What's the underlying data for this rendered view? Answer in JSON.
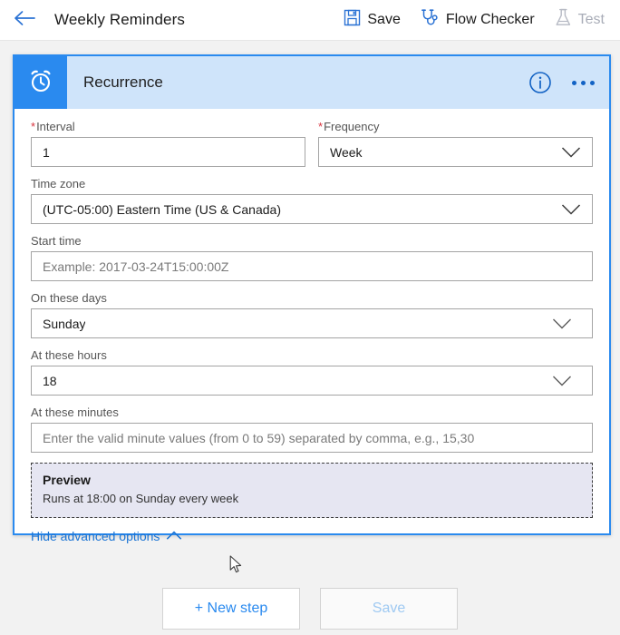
{
  "topbar": {
    "back_icon": "arrow-left-icon",
    "title": "Weekly Reminders",
    "actions": [
      {
        "label": "Save",
        "icon": "save-floppy-icon",
        "disabled": false
      },
      {
        "label": "Flow Checker",
        "icon": "stethoscope-icon",
        "disabled": false
      },
      {
        "label": "Test",
        "icon": "flask-icon",
        "disabled": true
      }
    ]
  },
  "card": {
    "icon": "alarm-clock-icon",
    "title": "Recurrence",
    "info_icon": "info-circle-icon",
    "more_icon": "ellipsis-icon",
    "accent_color": "#2a8aef",
    "header_bg": "#cfe4fa",
    "fields": {
      "interval": {
        "label": "Interval",
        "required": true,
        "value": "1",
        "type": "text"
      },
      "frequency": {
        "label": "Frequency",
        "required": true,
        "value": "Week",
        "type": "dropdown"
      },
      "timezone": {
        "label": "Time zone",
        "required": false,
        "value": "(UTC-05:00) Eastern Time (US & Canada)",
        "type": "dropdown"
      },
      "start_time": {
        "label": "Start time",
        "required": false,
        "value": "",
        "placeholder": "Example: 2017-03-24T15:00:00Z",
        "type": "text"
      },
      "on_these_days": {
        "label": "On these days",
        "required": false,
        "value": "Sunday",
        "type": "dropdown"
      },
      "at_these_hours": {
        "label": "At these hours",
        "required": false,
        "value": "18",
        "type": "dropdown"
      },
      "at_these_minutes": {
        "label": "At these minutes",
        "required": false,
        "value": "",
        "placeholder": "Enter the valid minute values (from 0 to 59) separated by comma, e.g., 15,30",
        "type": "text"
      }
    },
    "preview": {
      "title": "Preview",
      "text": "Runs at 18:00 on Sunday every week"
    },
    "advanced_link": {
      "label": "Hide advanced options",
      "icon": "chevron-up-icon"
    }
  },
  "footer": {
    "new_step_label": "+ New step",
    "save_label": "Save",
    "save_disabled": true
  }
}
